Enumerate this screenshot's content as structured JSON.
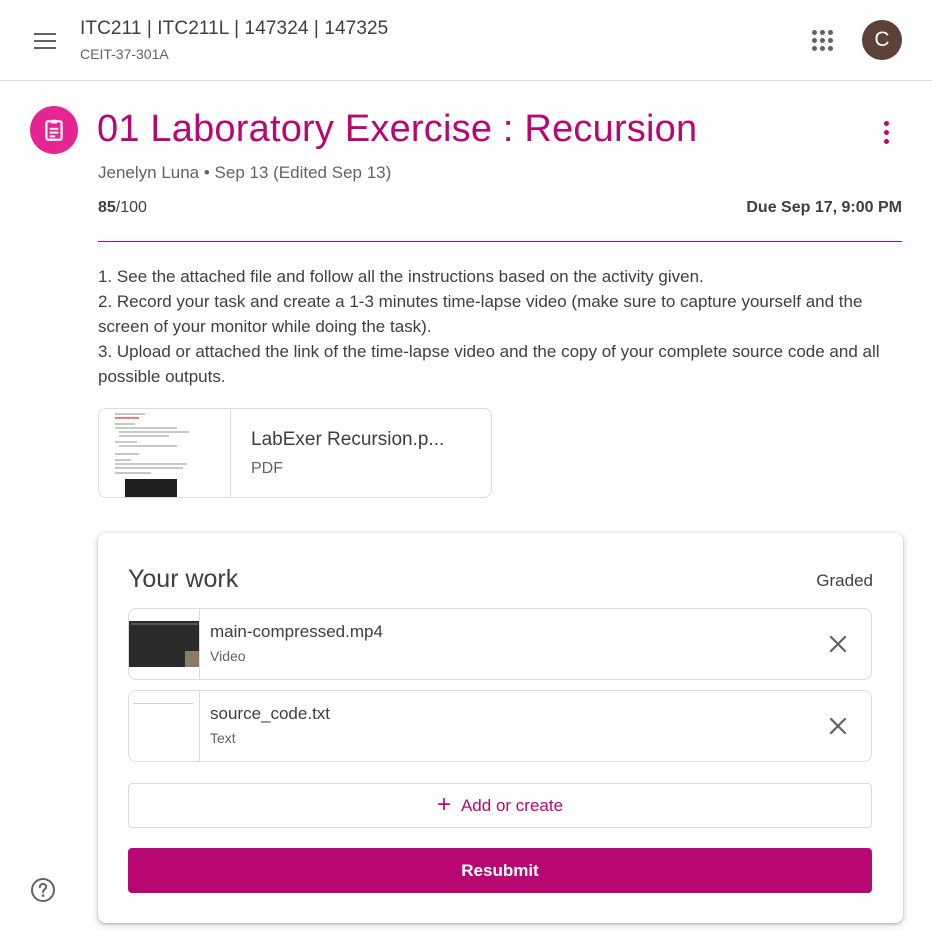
{
  "header": {
    "course_title": "ITC211 | ITC211L | 147324 | 147325",
    "course_section": "CEIT-37-301A",
    "avatar_letter": "C",
    "icons": {
      "menu": "hamburger-menu-icon",
      "apps": "apps-grid-icon"
    }
  },
  "assignment": {
    "title": "01 Laboratory Exercise : Recursion",
    "author_line": "Jenelyn Luna • Sep 13 (Edited Sep 13)",
    "points_earned": "85",
    "points_total": "/100",
    "due": "Due Sep 17, 9:00 PM",
    "instructions": [
      "1. See the attached file and follow all the instructions based on the activity given.",
      "2. Record your task and create a 1-3 minutes time-lapse video (make sure to capture yourself and the screen of your monitor while doing the task).",
      "3. Upload or attached the link of the time-lapse video and the copy of your complete source code and all possible outputs."
    ],
    "attachment": {
      "name": "LabExer Recursion.p...",
      "type": "PDF"
    }
  },
  "your_work": {
    "title": "Your work",
    "status": "Graded",
    "files": [
      {
        "name": "main-compressed.mp4",
        "type": "Video"
      },
      {
        "name": "source_code.txt",
        "type": "Text"
      }
    ],
    "add_label": "Add or create",
    "resubmit_label": "Resubmit"
  },
  "colors": {
    "accent": "#b80672",
    "assignment_icon_bg": "#e52592",
    "avatar_bg": "#5d4037",
    "divider": "#dadce0"
  }
}
